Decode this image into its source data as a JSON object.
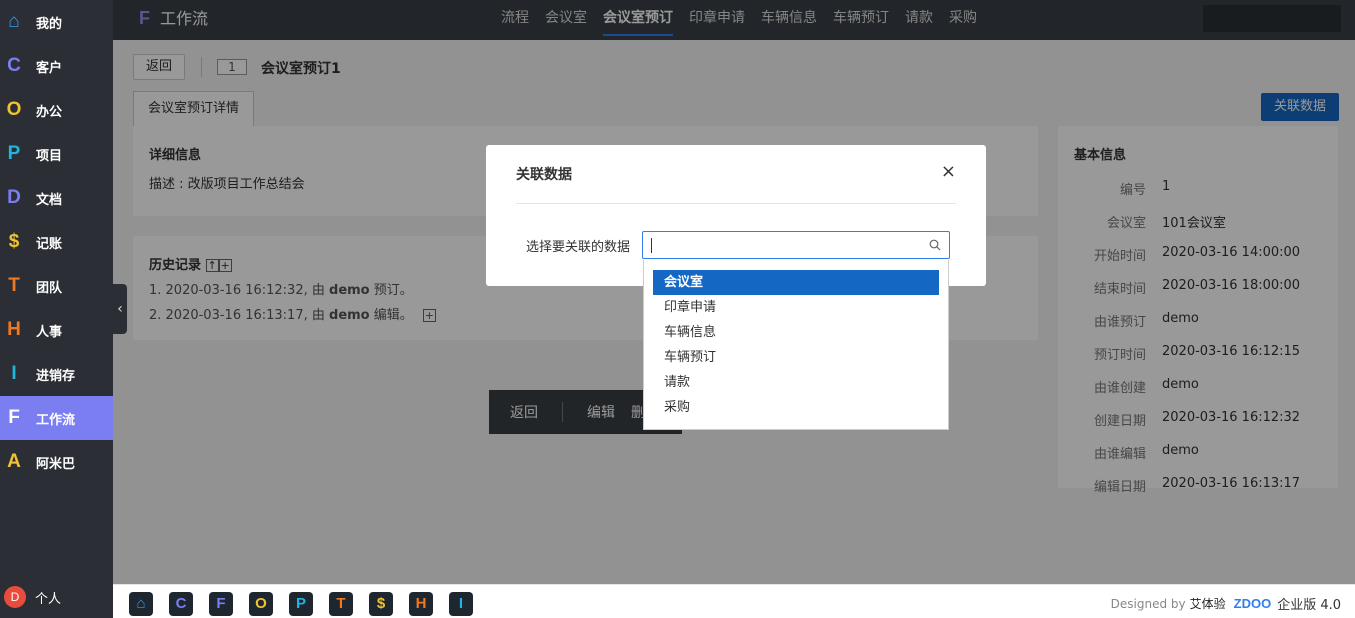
{
  "sidebar": {
    "items": [
      {
        "icon": "home-icon",
        "glyph": "⌂",
        "color": "#2f9ded",
        "label": "我的"
      },
      {
        "icon": "letter-c-icon",
        "glyph": "C",
        "color": "#7b7ef0",
        "label": "客户"
      },
      {
        "icon": "letter-o-icon",
        "glyph": "O",
        "color": "#f1c232",
        "label": "办公"
      },
      {
        "icon": "letter-p-icon",
        "glyph": "P",
        "color": "#1fb5e0",
        "label": "项目"
      },
      {
        "icon": "letter-d-icon",
        "glyph": "D",
        "color": "#7b7ef0",
        "label": "文档"
      },
      {
        "icon": "dollar-icon",
        "glyph": "$",
        "color": "#f1c232",
        "label": "记账"
      },
      {
        "icon": "letter-t-icon",
        "glyph": "T",
        "color": "#f0781e",
        "label": "团队"
      },
      {
        "icon": "letter-h-icon",
        "glyph": "H",
        "color": "#f0781e",
        "label": "人事"
      },
      {
        "icon": "letter-i-icon",
        "glyph": "I",
        "color": "#1fb5e0",
        "label": "进销存"
      },
      {
        "icon": "letter-f-icon",
        "glyph": "F",
        "color": "#ffffff",
        "label": "工作流"
      },
      {
        "icon": "letter-a-icon",
        "glyph": "A",
        "color": "#f1c232",
        "label": "阿米巴"
      }
    ],
    "user_avatar": "D",
    "user_label": "个人"
  },
  "topbar": {
    "logo_letter": "F",
    "title": "工作流",
    "menu": [
      "流程",
      "会议室",
      "会议室预订",
      "印章申请",
      "车辆信息",
      "车辆预订",
      "请款",
      "采购"
    ]
  },
  "main": {
    "back_label": "返回",
    "id_badge": "1",
    "page_title": "会议室预订1",
    "tab_label": "会议室预订详情",
    "link_button": "关联数据",
    "detail": {
      "title": "详细信息",
      "desc_label": "描述",
      "desc_value": "改版项目工作总结会"
    },
    "history": {
      "title": "历史记录",
      "lines": [
        {
          "prefix": "1. 2020-03-16 16:12:32, 由 ",
          "user": "demo",
          "action": " 预订。"
        },
        {
          "prefix": "2. 2020-03-16 16:13:17, 由 ",
          "user": "demo",
          "action": " 编辑。"
        }
      ]
    },
    "basic": {
      "title": "基本信息",
      "rows": [
        {
          "k": "编号",
          "v": "1"
        },
        {
          "k": "会议室",
          "v": "101会议室"
        },
        {
          "k": "开始时间",
          "v": "2020-03-16 14:00:00"
        },
        {
          "k": "结束时间",
          "v": "2020-03-16 18:00:00"
        },
        {
          "k": "由谁预订",
          "v": "demo"
        },
        {
          "k": "预订时间",
          "v": "2020-03-16 16:12:15"
        },
        {
          "k": "由谁创建",
          "v": "demo"
        },
        {
          "k": "创建日期",
          "v": "2020-03-16 16:12:32"
        },
        {
          "k": "由谁编辑",
          "v": "demo"
        },
        {
          "k": "编辑日期",
          "v": "2020-03-16 16:13:17"
        }
      ]
    },
    "actions": {
      "back": "返回",
      "edit": "编辑",
      "delete": "删"
    }
  },
  "modal": {
    "title": "关联数据",
    "close": "×",
    "field_label": "选择要关联的数据",
    "input_value": "",
    "options": [
      "会议室",
      "印章申请",
      "车辆信息",
      "车辆预订",
      "请款",
      "采购"
    ],
    "selected_index": 0
  },
  "bottombar": {
    "apps": [
      {
        "icon": "home-icon",
        "glyph": "⌂",
        "color": "#2f9ded"
      },
      {
        "icon": "letter-c-icon",
        "glyph": "C",
        "color": "#7b7ef0"
      },
      {
        "icon": "letter-f-icon",
        "glyph": "F",
        "color": "#7b7ef0"
      },
      {
        "icon": "letter-o-icon",
        "glyph": "O",
        "color": "#f1c232"
      },
      {
        "icon": "letter-p-icon",
        "glyph": "P",
        "color": "#1fb5e0"
      },
      {
        "icon": "letter-t-icon",
        "glyph": "T",
        "color": "#f0781e"
      },
      {
        "icon": "dollar-icon",
        "glyph": "$",
        "color": "#f1c232"
      },
      {
        "icon": "letter-h-icon",
        "glyph": "H",
        "color": "#f0781e"
      },
      {
        "icon": "letter-i-icon",
        "glyph": "I",
        "color": "#1fb5e0"
      }
    ],
    "designed_by": "Designed by",
    "brand": "艾体验",
    "zdoo": "ZDOO",
    "edition": "企业版 4.0"
  },
  "colors": {
    "accent": "#1468c4",
    "active_sidebar": "#7b7ef0",
    "sidebar_bg": "#2b2f35",
    "topbar_bg": "#3a4048"
  }
}
